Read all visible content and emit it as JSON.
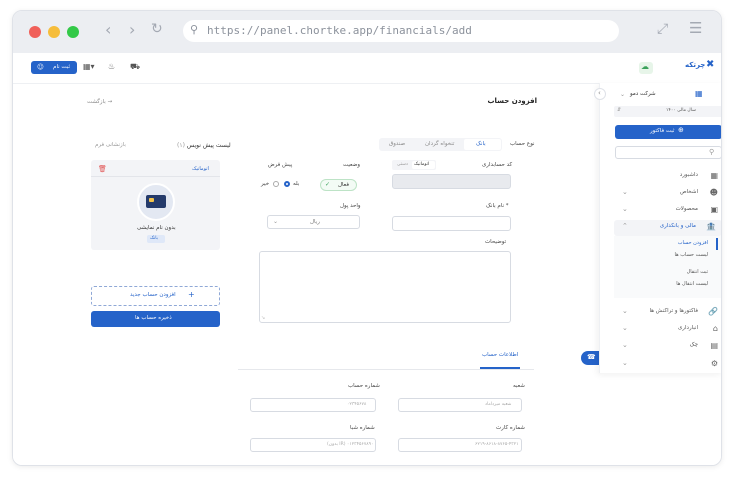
{
  "browser": {
    "url": "https://panel.chortke.app/financials/add"
  },
  "topbar": {
    "register_button": "ثبت نام",
    "brand": "چرتکه"
  },
  "sidebar": {
    "company": "شرکت دمو",
    "fiscal_year": "سال مالی ۱۴۰۰",
    "invoice_button": "ثبت فاکتور",
    "items": [
      {
        "label": "داشبورد"
      },
      {
        "label": "اشخاص"
      },
      {
        "label": "محصولات"
      },
      {
        "label": "مالی و بانکداری"
      },
      {
        "label": "افزودن حساب"
      },
      {
        "label": "لیست حساب ها"
      },
      {
        "label": "ثبت انتقال"
      },
      {
        "label": "لیست انتقال ها"
      },
      {
        "label": "فاکتورها و تراکنش ها"
      },
      {
        "label": "انبارداری"
      },
      {
        "label": "چک"
      }
    ]
  },
  "main": {
    "title": "افزودن حساب",
    "back": "بازگشت",
    "account_type_label": "نوع حساب",
    "account_types": [
      "بانک",
      "تنخواه گردان",
      "صندوق"
    ],
    "accounting_code_label": "کد حسابداری",
    "code_modes": [
      "اتوماتیک",
      "دستی"
    ],
    "status_label": "وضعیت",
    "status_value": "فعال",
    "default_label": "پیش فرض",
    "default_yes": "بله",
    "default_no": "خیر",
    "bank_name_label": "نام بانک *",
    "currency_label": "واحد پول",
    "currency_value": "ریال",
    "description_label": "توضیحات",
    "account_info_tab": "اطلاعات حساب",
    "branch_label": "شعبه",
    "branch_placeholder": "شعبه میرداماد",
    "account_number_label": "شماره حساب",
    "account_number_placeholder": "۰۲۳۴۵۶۷۸",
    "card_number_label": "شماره کارت",
    "card_number_placeholder": "۶۲۱۹-۸۶۱۸-۸۷۶۵-۴۳۲۱",
    "sheba_label": "شماره شبا",
    "sheba_placeholder": "(بدون IR) ۰۱۲۳۴۵۶۷۸۹۰"
  },
  "preview": {
    "title": "لیست پیش نویس",
    "count": "(۱)",
    "reset": "بازنشانی فرم",
    "auto_label": "اتوماتیک",
    "card_name": "بدون نام نمایشی",
    "card_type": "بانک",
    "add_new": "افزودن حساب جدید",
    "save": "ذخیره حساب ها"
  },
  "colors": {
    "primary": "#2563c9",
    "danger": "#e05252",
    "success": "#3aa15a"
  }
}
